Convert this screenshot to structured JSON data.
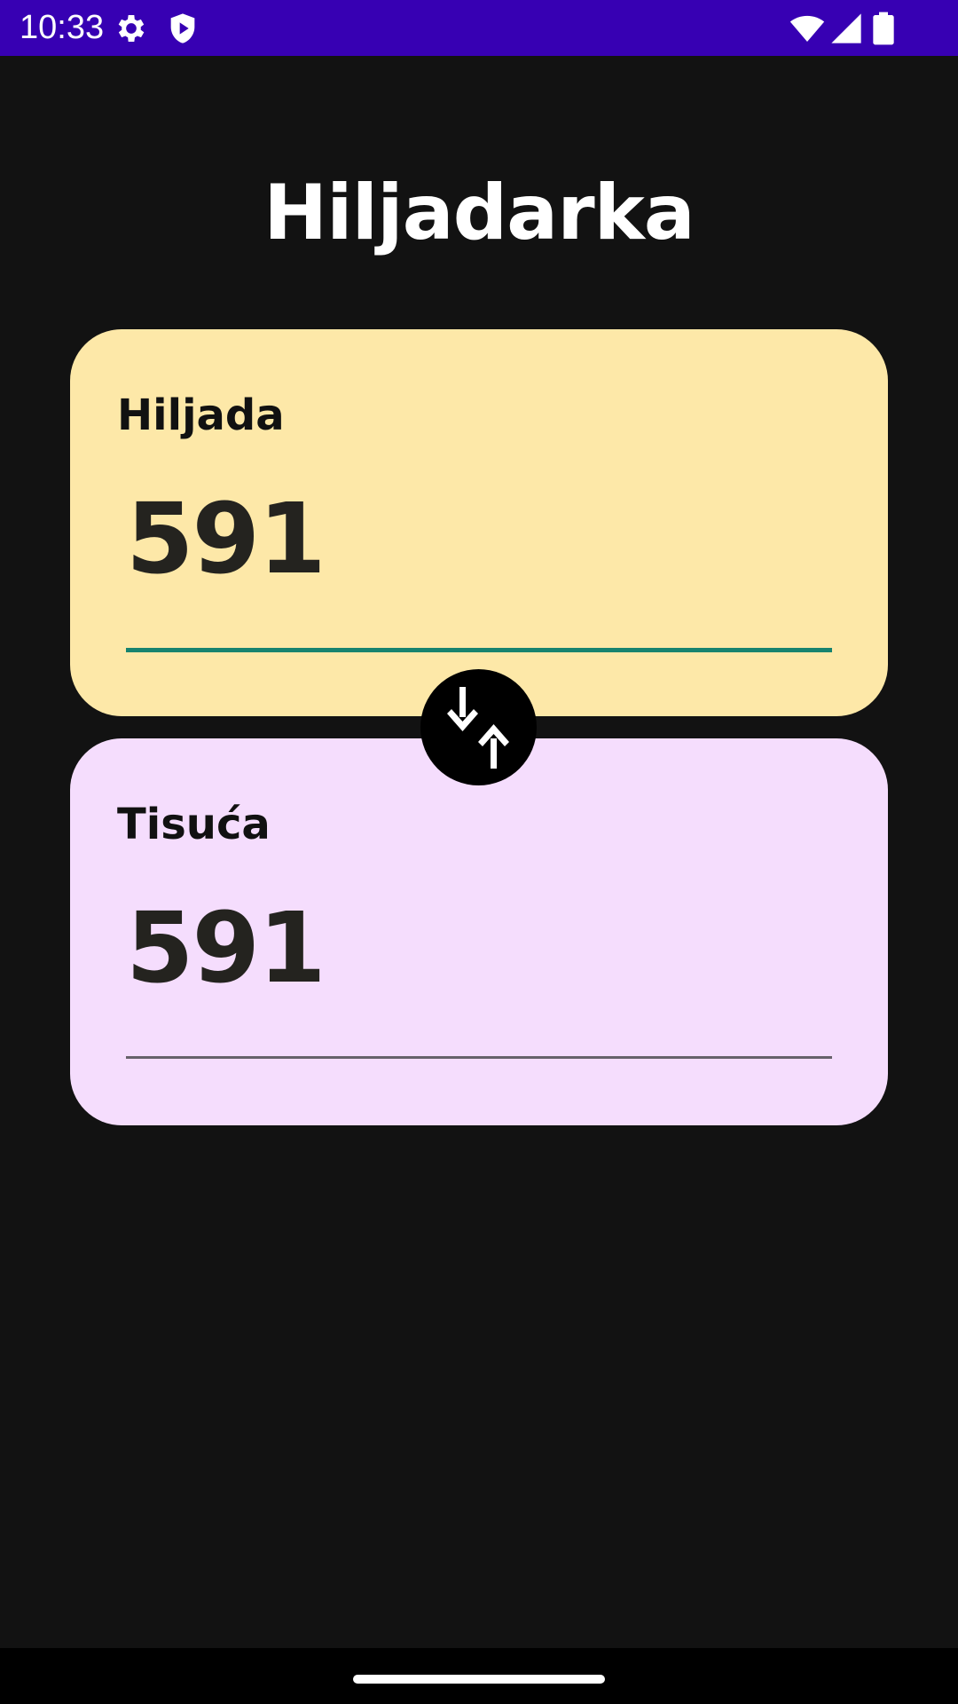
{
  "status_bar": {
    "time": "10:33",
    "background": "#3700b3",
    "icons": [
      "settings-gear-icon",
      "shield-play-icon",
      "wifi-icon",
      "cellular-signal-icon",
      "battery-icon"
    ]
  },
  "app": {
    "title": "Hiljadarka",
    "background": "#121212"
  },
  "fields": [
    {
      "label": "Hiljada",
      "value": "591",
      "background": "#fde8a8",
      "underline": "#17836f",
      "focused": true
    },
    {
      "label": "Tisuća",
      "value": "591",
      "background": "#f5ddfd",
      "underline": "#66616a",
      "focused": false
    }
  ],
  "swap_button": {
    "icon": "swap-vertical-arrows-icon"
  },
  "nav_bar": {
    "icon": "home-gesture-handle"
  }
}
